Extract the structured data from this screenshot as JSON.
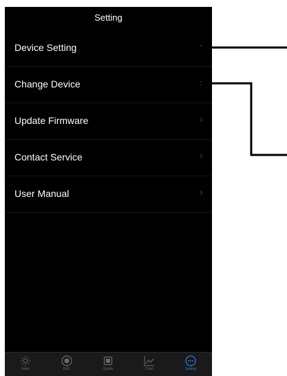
{
  "header": {
    "title": "Setting"
  },
  "menu": {
    "items": [
      {
        "label": "Device Setting",
        "chevron": "›"
      },
      {
        "label": "Change Device",
        "chevron": "›"
      },
      {
        "label": "Update Firmware",
        "chevron": "›"
      },
      {
        "label": "Contact Service",
        "chevron": "›"
      },
      {
        "label": "User Manual",
        "chevron": "›"
      }
    ]
  },
  "tabbar": {
    "tabs": [
      {
        "label": "Value",
        "icon": "sun-icon"
      },
      {
        "label": "EML",
        "icon": "target-icon"
      },
      {
        "label": "Quality",
        "icon": "chip-icon"
      },
      {
        "label": "Chart",
        "icon": "line-chart-icon"
      },
      {
        "label": "Setting",
        "icon": "more-circle-icon",
        "active": true
      }
    ],
    "active_color": "#2a7ce0",
    "inactive_color": "#6a6a6a"
  }
}
